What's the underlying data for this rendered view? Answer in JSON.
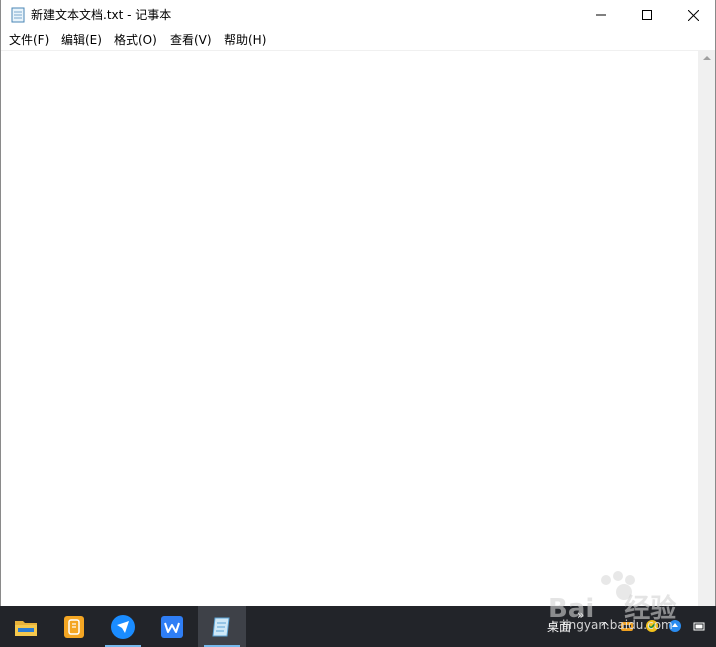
{
  "window": {
    "title": "新建文本文档.txt - 记事本"
  },
  "menu": [
    {
      "label": "文件(F)"
    },
    {
      "label": "编辑(E)"
    },
    {
      "label": "格式(O)"
    },
    {
      "label": "查看(V)"
    },
    {
      "label": "帮助(H)"
    }
  ],
  "editor": {
    "content": ""
  },
  "taskbar": {
    "apps": [
      {
        "icon": "file-explorer-icon",
        "active": false
      },
      {
        "icon": "notes-app-icon",
        "active": false
      },
      {
        "icon": "feishu-app-icon",
        "active": false
      },
      {
        "icon": "wps-office-icon",
        "active": false
      },
      {
        "icon": "notepad-icon",
        "active": true
      }
    ],
    "tray": {
      "desktop_label": "桌面",
      "overflow_symbol": "»",
      "up_chevron": "^"
    }
  },
  "watermark": {
    "brand": "Bai",
    "brand_suffix": "经验",
    "url": "jingyan.baidu.com"
  },
  "colors": {
    "taskbar": "#222429",
    "accent": "#76b9ed"
  }
}
